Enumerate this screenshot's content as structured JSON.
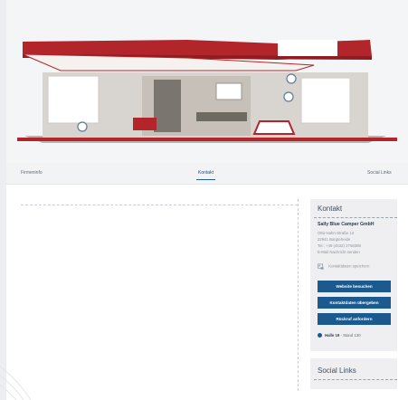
{
  "tabs": [
    {
      "label": "Firmeninfo"
    },
    {
      "label": "Kontakt"
    },
    {
      "label": "Social Links"
    }
  ],
  "contact": {
    "title": "Kontakt",
    "company": "Sally Blue Camper GmbH",
    "street": "Otto-Hahn-Straße 13",
    "city": "22941 Bargteheide",
    "phone": "Tel.: +49 (4532) 2768388",
    "email": "E-Mail Nachricht senden",
    "save_label": "Kontaktdaten speichern",
    "buttons": {
      "website": "Website besuchen",
      "share": "Kontaktdaten übergeben",
      "callback": "Rückruf anfordern"
    },
    "hall": "Halle 19",
    "stand": " - Stand 130"
  },
  "social": {
    "title": "Social Links"
  },
  "colors": {
    "accent_red": "#b2262b",
    "button_blue": "#1b5a8e"
  }
}
